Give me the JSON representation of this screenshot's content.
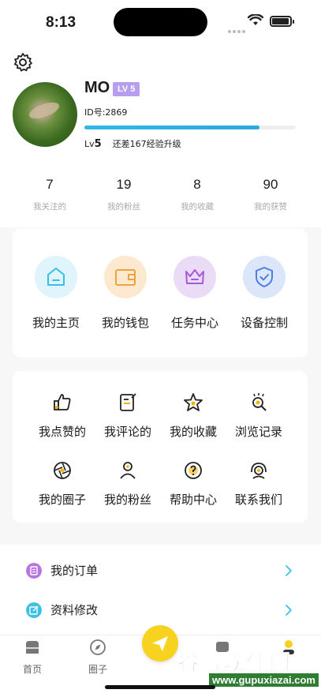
{
  "status_bar": {
    "time": "8:13"
  },
  "profile": {
    "username": "MO",
    "level_badge": "LV 5",
    "user_id": "ID号:2869",
    "level_prefix": "Lv",
    "level_number": "5",
    "level_hint": "还差167经验升级",
    "progress_fraction": 0.83
  },
  "stats": [
    {
      "value": "7",
      "label": "我关注的"
    },
    {
      "value": "19",
      "label": "我的粉丝"
    },
    {
      "value": "8",
      "label": "我的收藏"
    },
    {
      "value": "90",
      "label": "我的获赞"
    }
  ],
  "features": [
    {
      "label": "我的主页",
      "icon": "home-icon",
      "color": "#dff4fb",
      "stroke": "#35c0e6"
    },
    {
      "label": "我的钱包",
      "icon": "wallet-icon",
      "color": "#fde9cf",
      "stroke": "#f0a23a"
    },
    {
      "label": "任务中心",
      "icon": "crown-icon",
      "color": "#eadcf7",
      "stroke": "#a55ad6"
    },
    {
      "label": "设备控制",
      "icon": "shield-icon",
      "color": "#dbe6fb",
      "stroke": "#4a7fe0"
    }
  ],
  "grid": [
    {
      "label": "我点赞的",
      "icon": "thumbs-up-icon"
    },
    {
      "label": "我评论的",
      "icon": "comment-edit-icon"
    },
    {
      "label": "我的收藏",
      "icon": "star-icon"
    },
    {
      "label": "浏览记录",
      "icon": "history-icon"
    },
    {
      "label": "我的圈子",
      "icon": "circle-aperture-icon"
    },
    {
      "label": "我的粉丝",
      "icon": "person-icon"
    },
    {
      "label": "帮助中心",
      "icon": "help-icon"
    },
    {
      "label": "联系我们",
      "icon": "headset-icon"
    }
  ],
  "list": [
    {
      "label": "我的订单",
      "icon": "order-icon",
      "color": "#b874e0"
    },
    {
      "label": "资料修改",
      "icon": "edit-profile-icon",
      "color": "#3cc1e3"
    }
  ],
  "tabbar": [
    {
      "label": "首页",
      "icon": "home-tab-icon"
    },
    {
      "label": "圈子",
      "icon": "compass-icon"
    },
    {
      "label": "",
      "icon": "send-icon"
    },
    {
      "label": "",
      "icon": "message-icon"
    },
    {
      "label": "",
      "icon": "profile-icon"
    }
  ],
  "watermark": {
    "main": "谷普软件园",
    "sub": "www.gupuxiazai.com"
  },
  "colors": {
    "accent_blue": "#2aa9de",
    "badge_purple": "#b79ef0",
    "fab_yellow": "#f7d21f",
    "chevron_cyan": "#3cc1e3"
  }
}
